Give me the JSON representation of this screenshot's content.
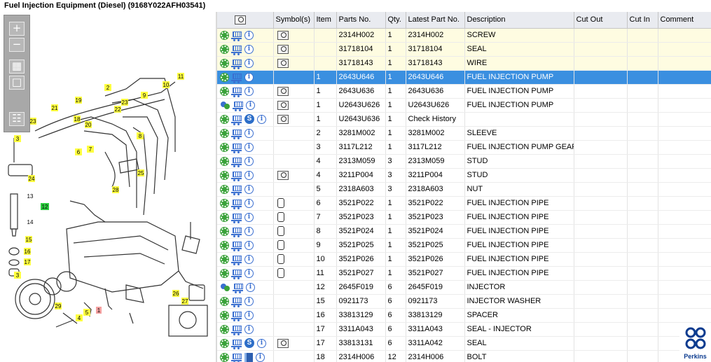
{
  "title": "Fuel Injection Equipment (Diesel) (9168Y022AFH03541)",
  "toolbar": {
    "zoom_in": "+",
    "zoom_out": "−",
    "fit": "▦",
    "reset": "□",
    "list": "☷"
  },
  "callouts": [
    "2",
    "11",
    "10",
    "9",
    "23",
    "22",
    "19",
    "21",
    "20",
    "18",
    "23",
    "8",
    "7",
    "6",
    "3",
    "24",
    "25",
    "28",
    "12",
    "13",
    "14",
    "15",
    "16",
    "17",
    "3",
    "29",
    "4",
    "5",
    "1",
    "26",
    "27"
  ],
  "columns": [
    "",
    "Symbol(s)",
    "Item",
    "Parts No.",
    "Qty.",
    "Latest Part No.",
    "Description",
    "Cut Out",
    "Cut In",
    "Comment"
  ],
  "rows": [
    {
      "icons": [
        "gear",
        "cart",
        "info"
      ],
      "sym": "lens",
      "item": "",
      "part": "2314H002",
      "qty": "1",
      "latest": "2314H002",
      "desc": "SCREW",
      "state": "hl"
    },
    {
      "icons": [
        "gear",
        "cart",
        "info"
      ],
      "sym": "lens",
      "item": "",
      "part": "31718104",
      "qty": "1",
      "latest": "31718104",
      "desc": "SEAL",
      "state": "hl"
    },
    {
      "icons": [
        "gear",
        "cart",
        "info"
      ],
      "sym": "lens",
      "item": "",
      "part": "31718143",
      "qty": "1",
      "latest": "31718143",
      "desc": "WIRE",
      "state": "hl"
    },
    {
      "icons": [
        "gear",
        "cart",
        "info"
      ],
      "sym": "",
      "item": "1",
      "part": "2643U646",
      "qty": "1",
      "latest": "2643U646",
      "desc": "FUEL INJECTION PUMP",
      "state": "sel"
    },
    {
      "icons": [
        "gear",
        "cart",
        "info"
      ],
      "sym": "lens",
      "item": "1",
      "part": "2643U636",
      "qty": "1",
      "latest": "2643U636",
      "desc": "FUEL INJECTION PUMP",
      "state": ""
    },
    {
      "icons": [
        "gear2",
        "cart",
        "info"
      ],
      "sym": "lens",
      "item": "1",
      "part": "U2643U626",
      "qty": "1",
      "latest": "U2643U626",
      "desc": "FUEL INJECTION PUMP",
      "state": ""
    },
    {
      "icons": [
        "gear",
        "cart",
        "s",
        "info"
      ],
      "sym": "lens",
      "item": "1",
      "part": "U2643U636",
      "qty": "1",
      "latest": "Check History",
      "desc": "",
      "state": ""
    },
    {
      "icons": [
        "gear",
        "cart",
        "info"
      ],
      "sym": "",
      "item": "2",
      "part": "3281M002",
      "qty": "1",
      "latest": "3281M002",
      "desc": "SLEEVE",
      "state": ""
    },
    {
      "icons": [
        "gear",
        "cart",
        "info"
      ],
      "sym": "",
      "item": "3",
      "part": "3117L212",
      "qty": "1",
      "latest": "3117L212",
      "desc": "FUEL INJECTION PUMP GEAR",
      "state": ""
    },
    {
      "icons": [
        "gear",
        "cart",
        "info"
      ],
      "sym": "",
      "item": "4",
      "part": "2313M059",
      "qty": "3",
      "latest": "2313M059",
      "desc": "STUD",
      "state": ""
    },
    {
      "icons": [
        "gear",
        "cart",
        "info"
      ],
      "sym": "lens",
      "item": "4",
      "part": "3211P004",
      "qty": "3",
      "latest": "3211P004",
      "desc": "STUD",
      "state": ""
    },
    {
      "icons": [
        "gear",
        "cart",
        "info"
      ],
      "sym": "",
      "item": "5",
      "part": "2318A603",
      "qty": "3",
      "latest": "2318A603",
      "desc": "NUT",
      "state": ""
    },
    {
      "icons": [
        "gear",
        "cart",
        "info"
      ],
      "sym": "can",
      "item": "6",
      "part": "3521P022",
      "qty": "1",
      "latest": "3521P022",
      "desc": "FUEL INJECTION PIPE",
      "state": ""
    },
    {
      "icons": [
        "gear",
        "cart",
        "info"
      ],
      "sym": "can",
      "item": "7",
      "part": "3521P023",
      "qty": "1",
      "latest": "3521P023",
      "desc": "FUEL INJECTION PIPE",
      "state": ""
    },
    {
      "icons": [
        "gear",
        "cart",
        "info"
      ],
      "sym": "can",
      "item": "8",
      "part": "3521P024",
      "qty": "1",
      "latest": "3521P024",
      "desc": "FUEL INJECTION PIPE",
      "state": ""
    },
    {
      "icons": [
        "gear",
        "cart",
        "info"
      ],
      "sym": "can",
      "item": "9",
      "part": "3521P025",
      "qty": "1",
      "latest": "3521P025",
      "desc": "FUEL INJECTION PIPE",
      "state": ""
    },
    {
      "icons": [
        "gear",
        "cart",
        "info"
      ],
      "sym": "can",
      "item": "10",
      "part": "3521P026",
      "qty": "1",
      "latest": "3521P026",
      "desc": "FUEL INJECTION PIPE",
      "state": ""
    },
    {
      "icons": [
        "gear",
        "cart",
        "info"
      ],
      "sym": "can",
      "item": "11",
      "part": "3521P027",
      "qty": "1",
      "latest": "3521P027",
      "desc": "FUEL INJECTION PIPE",
      "state": ""
    },
    {
      "icons": [
        "gear2",
        "cart",
        "info"
      ],
      "sym": "",
      "item": "12",
      "part": "2645F019",
      "qty": "6",
      "latest": "2645F019",
      "desc": "INJECTOR",
      "state": ""
    },
    {
      "icons": [
        "gear",
        "cart",
        "info"
      ],
      "sym": "",
      "item": "15",
      "part": "0921173",
      "qty": "6",
      "latest": "0921173",
      "desc": "INJECTOR WASHER",
      "state": ""
    },
    {
      "icons": [
        "gear",
        "cart",
        "info"
      ],
      "sym": "",
      "item": "16",
      "part": "33813129",
      "qty": "6",
      "latest": "33813129",
      "desc": "SPACER",
      "state": ""
    },
    {
      "icons": [
        "gear",
        "cart",
        "info"
      ],
      "sym": "",
      "item": "17",
      "part": "3311A043",
      "qty": "6",
      "latest": "3311A043",
      "desc": "SEAL - INJECTOR",
      "state": ""
    },
    {
      "icons": [
        "gear",
        "cart",
        "s",
        "info"
      ],
      "sym": "lens",
      "item": "17",
      "part": "33813131",
      "qty": "6",
      "latest": "3311A042",
      "desc": "SEAL",
      "state": ""
    },
    {
      "icons": [
        "gear",
        "cart",
        "book",
        "info"
      ],
      "sym": "",
      "item": "18",
      "part": "2314H006",
      "qty": "12",
      "latest": "2314H006",
      "desc": "BOLT",
      "state": ""
    }
  ],
  "logo": {
    "label": "Perkins"
  }
}
